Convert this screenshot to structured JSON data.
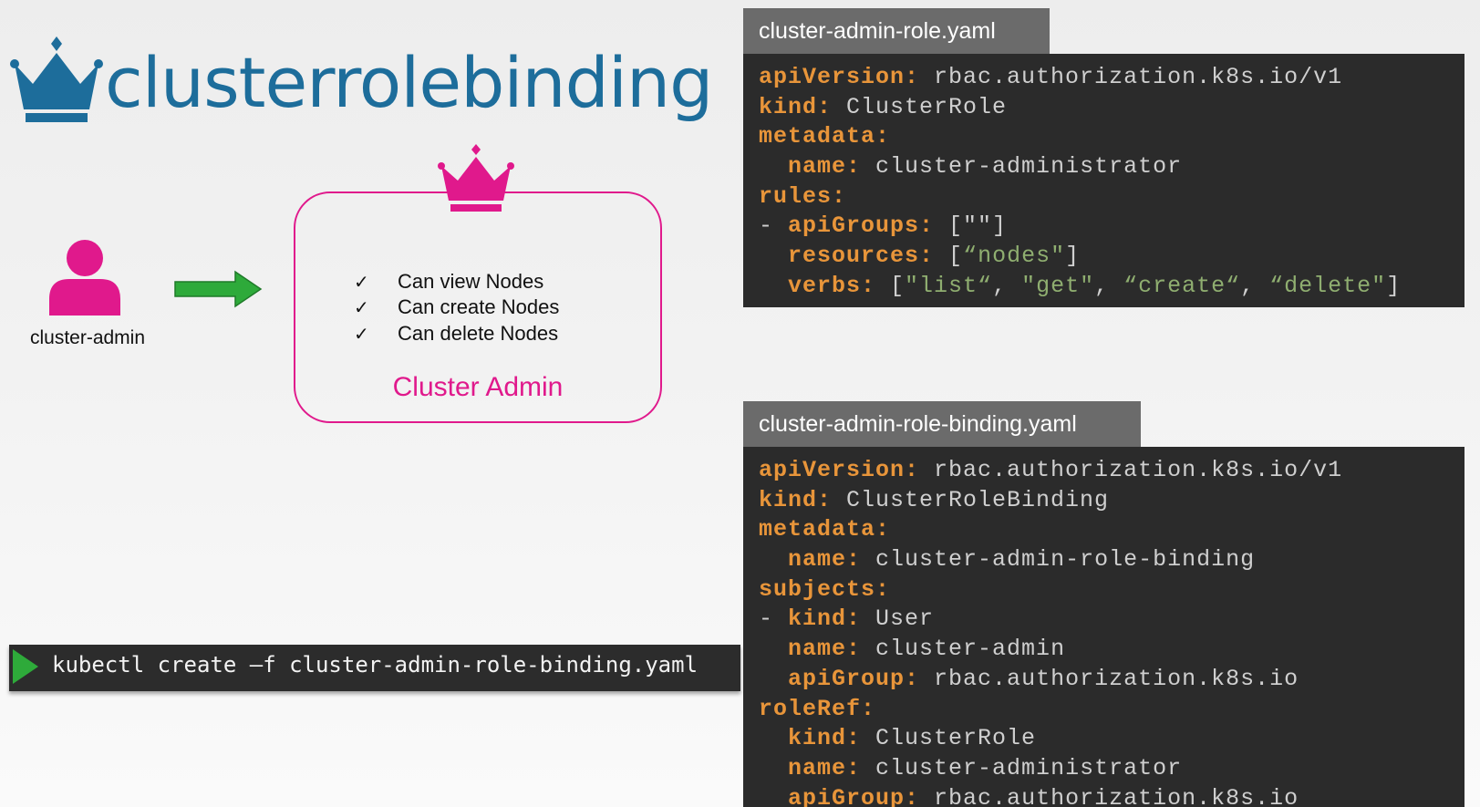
{
  "title": "clusterrolebinding",
  "colors": {
    "brand": "#1d6d9b",
    "accent": "#e0198c",
    "arrow": "#2eaa3a",
    "panel_bg": "#2b2b2b",
    "tab_bg": "#6b6b6b",
    "yaml_key": "#e8953a"
  },
  "icons": {
    "title": "crown-icon",
    "user": "user-icon",
    "role": "crown-icon",
    "arrow": "right-arrow-icon",
    "run": "play-icon"
  },
  "user": {
    "label": "cluster-admin"
  },
  "role_box": {
    "check_glyph": "✓",
    "permissions": [
      "Can view Nodes",
      "Can create Nodes",
      "Can delete Nodes"
    ],
    "name": "Cluster Admin"
  },
  "command": {
    "text": "kubectl create –f cluster-admin-role-binding.yaml"
  },
  "role_file": {
    "tab": "cluster-admin-role.yaml",
    "lines": [
      [
        {
          "t": "k",
          "s": "apiVersion:"
        },
        {
          "t": "v",
          "s": " rbac.authorization.k8s.io/v1"
        }
      ],
      [
        {
          "t": "k",
          "s": "kind:"
        },
        {
          "t": "v",
          "s": " ClusterRole"
        }
      ],
      [
        {
          "t": "k",
          "s": "metadata:"
        }
      ],
      [
        {
          "t": "v",
          "s": "  "
        },
        {
          "t": "k",
          "s": "name:"
        },
        {
          "t": "v",
          "s": " cluster-administrator"
        }
      ],
      [
        {
          "t": "k",
          "s": "rules:"
        }
      ],
      [
        {
          "t": "v",
          "s": "- "
        },
        {
          "t": "k",
          "s": "apiGroups:"
        },
        {
          "t": "p",
          "s": " [\"\"]"
        }
      ],
      [
        {
          "t": "v",
          "s": "  "
        },
        {
          "t": "k",
          "s": "resources:"
        },
        {
          "t": "p",
          "s": " ["
        },
        {
          "t": "s",
          "s": "“nodes\""
        },
        {
          "t": "p",
          "s": "]"
        }
      ],
      [
        {
          "t": "v",
          "s": "  "
        },
        {
          "t": "k",
          "s": "verbs:"
        },
        {
          "t": "p",
          "s": " ["
        },
        {
          "t": "s",
          "s": "\"list“"
        },
        {
          "t": "p",
          "s": ", "
        },
        {
          "t": "s",
          "s": "\"get\""
        },
        {
          "t": "p",
          "s": ", "
        },
        {
          "t": "s",
          "s": "“create“"
        },
        {
          "t": "p",
          "s": ", "
        },
        {
          "t": "s",
          "s": "“delete\""
        },
        {
          "t": "p",
          "s": "]"
        }
      ]
    ]
  },
  "binding_file": {
    "tab": "cluster-admin-role-binding.yaml",
    "lines": [
      [
        {
          "t": "k",
          "s": "apiVersion:"
        },
        {
          "t": "v",
          "s": " rbac.authorization.k8s.io/v1"
        }
      ],
      [
        {
          "t": "k",
          "s": "kind:"
        },
        {
          "t": "v",
          "s": " ClusterRoleBinding"
        }
      ],
      [
        {
          "t": "k",
          "s": "metadata:"
        }
      ],
      [
        {
          "t": "v",
          "s": "  "
        },
        {
          "t": "k",
          "s": "name:"
        },
        {
          "t": "v",
          "s": " cluster-admin-role-binding"
        }
      ],
      [
        {
          "t": "k",
          "s": "subjects:"
        }
      ],
      [
        {
          "t": "v",
          "s": "- "
        },
        {
          "t": "k",
          "s": "kind:"
        },
        {
          "t": "v",
          "s": " User"
        }
      ],
      [
        {
          "t": "v",
          "s": "  "
        },
        {
          "t": "k",
          "s": "name:"
        },
        {
          "t": "v",
          "s": " cluster-admin"
        }
      ],
      [
        {
          "t": "v",
          "s": "  "
        },
        {
          "t": "k",
          "s": "apiGroup:"
        },
        {
          "t": "v",
          "s": " rbac.authorization.k8s.io"
        }
      ],
      [
        {
          "t": "k",
          "s": "roleRef:"
        }
      ],
      [
        {
          "t": "v",
          "s": "  "
        },
        {
          "t": "k",
          "s": "kind:"
        },
        {
          "t": "v",
          "s": " ClusterRole"
        }
      ],
      [
        {
          "t": "v",
          "s": "  "
        },
        {
          "t": "k",
          "s": "name:"
        },
        {
          "t": "v",
          "s": " cluster-administrator"
        }
      ],
      [
        {
          "t": "v",
          "s": "  "
        },
        {
          "t": "k",
          "s": "apiGroup:"
        },
        {
          "t": "v",
          "s": " rbac.authorization.k8s.io"
        }
      ]
    ]
  }
}
